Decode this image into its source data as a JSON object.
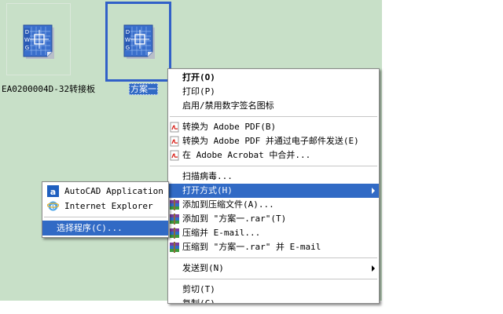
{
  "desktop": {
    "files": [
      {
        "name": "EA0200004D-32转接板",
        "icon": "dwg-file-icon",
        "selected": false
      },
      {
        "name": "方案一",
        "icon": "dwg-file-icon",
        "selected": true
      }
    ]
  },
  "context_menu": {
    "items": [
      {
        "label": "打开(O)",
        "bold": true
      },
      {
        "label": "打印(P)"
      },
      {
        "label": "启用/禁用数字签名图标"
      },
      {
        "separator": true
      },
      {
        "label": "转换为 Adobe PDF(B)",
        "icon": "adobe-pdf-icon"
      },
      {
        "label": "转换为 Adobe PDF 并通过电子邮件发送(E)",
        "icon": "adobe-pdf-icon"
      },
      {
        "label": "在 Adobe Acrobat 中合并...",
        "icon": "adobe-pdf-icon"
      },
      {
        "separator": true
      },
      {
        "label": "扫描病毒..."
      },
      {
        "label": "打开方式(H)",
        "highlighted": true,
        "submenu": true
      },
      {
        "label": "添加到压缩文件(A)...",
        "icon": "winrar-icon"
      },
      {
        "label": "添加到 \"方案一.rar\"(T)",
        "icon": "winrar-icon"
      },
      {
        "label": "压缩并 E-mail...",
        "icon": "winrar-icon"
      },
      {
        "label": "压缩到 \"方案一.rar\" 并 E-mail",
        "icon": "winrar-icon"
      },
      {
        "separator": true
      },
      {
        "label": "发送到(N)",
        "submenu": true
      },
      {
        "separator": true
      },
      {
        "label": "剪切(T)"
      },
      {
        "label": "复制(C)"
      }
    ]
  },
  "open_with_submenu": {
    "items": [
      {
        "label": "AutoCAD Application",
        "icon": "autocad-icon"
      },
      {
        "label": "Internet Explorer",
        "icon": "internet-explorer-icon"
      },
      {
        "separator": true
      },
      {
        "label": "选择程序(C)...",
        "highlighted": true
      }
    ]
  },
  "colors": {
    "desktop_bg": "#c8e0c8",
    "highlight": "#316ac5",
    "selection_border": "#3160c8"
  }
}
